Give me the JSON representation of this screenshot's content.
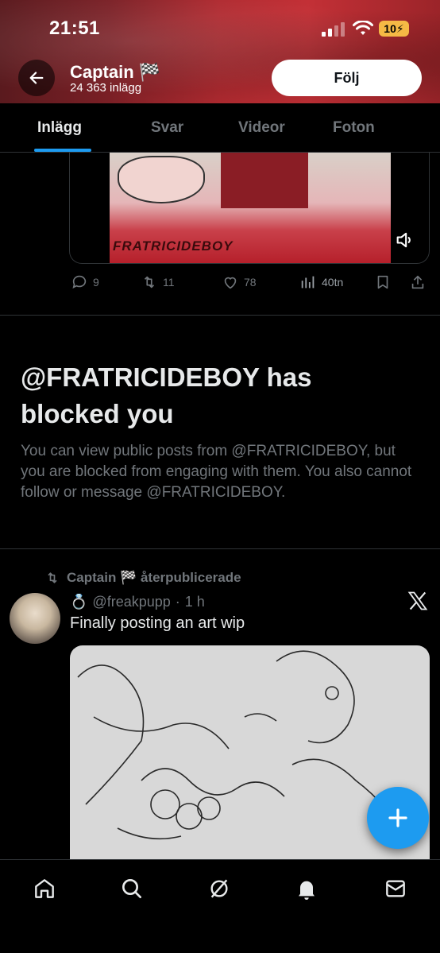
{
  "status_bar": {
    "time": "21:51",
    "battery": "10"
  },
  "header": {
    "profile_name": "Captain 🏁",
    "post_count": "24 363 inlägg",
    "follow_label": "Följ"
  },
  "tabs": [
    {
      "label": "Inlägg",
      "active": true
    },
    {
      "label": "Svar",
      "active": false
    },
    {
      "label": "Videor",
      "active": false
    },
    {
      "label": "Foton",
      "active": false
    }
  ],
  "top_post": {
    "media_caption": "FRATRICIDEBOY",
    "replies": "9",
    "reposts": "11",
    "likes": "78",
    "views": "40tn"
  },
  "blocked": {
    "title": "@FRATRICIDEBOY has blocked you",
    "description": "You can view public posts from @FRATRICIDEBOY, but you are blocked from engaging with them. You also cannot follow or message @FRATRICIDEBOY."
  },
  "repost": {
    "label": "Captain 🏁 återpublicerade",
    "author_emoji": "💍",
    "handle": "@freakpupp",
    "time": "1 h",
    "text": "Finally posting an art wip"
  },
  "nav": {
    "items": [
      "home-icon",
      "search-icon",
      "grok-icon",
      "notifications-icon",
      "messages-icon"
    ]
  },
  "colors": {
    "accent": "#1d9bf0",
    "muted": "#71767b",
    "text": "#e7e9ea",
    "border": "#2f3336"
  }
}
